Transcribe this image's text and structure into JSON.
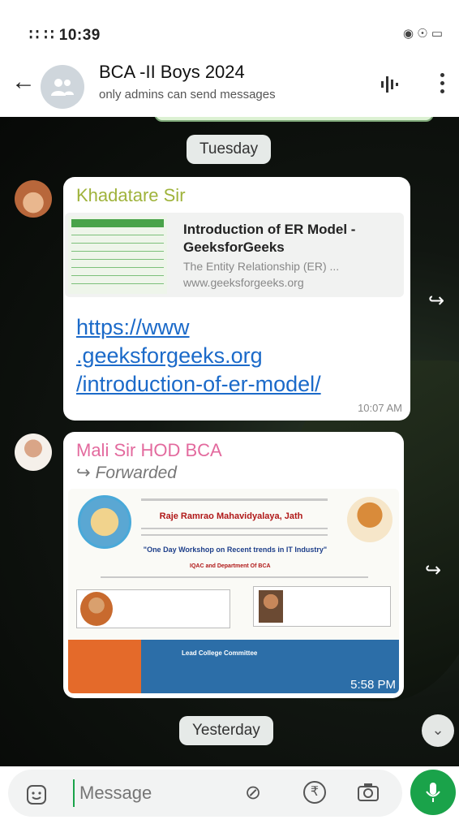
{
  "status_bar": {
    "time": "10:39",
    "left_icons": "∷ ∷",
    "right_icons": "◉ ☉ ▭"
  },
  "header": {
    "title": "BCA -II Boys 2024",
    "subtitle": "only admins can send messages"
  },
  "chat": {
    "date_chips": [
      "Tuesday",
      "Yesterday"
    ],
    "messages": [
      {
        "sender": "Khadatare Sir",
        "link_preview": {
          "title": "Introduction of ER Model - GeeksforGeeks",
          "description": "The Entity Relationship (ER) ...",
          "host": "www.geeksforgeeks.org"
        },
        "link": "https://www\n.geeksforgeeks.org\n/introduction-of-er-model/",
        "time": "10:07 AM"
      },
      {
        "sender": "Mali Sir HOD BCA",
        "forwarded_label": "Forwarded",
        "image_text": {
          "college": "Raje Ramrao Mahavidyalaya, Jath",
          "workshop": "\"One Day Workshop on Recent trends in IT Industry\"",
          "organizer": "IQAC and Department Of BCA",
          "band": "Lead College Committee"
        },
        "time": "5:58 PM"
      }
    ]
  },
  "input": {
    "placeholder": "Message"
  },
  "colors": {
    "accent": "#1aa34a",
    "sender1": "#9fb33b",
    "sender2": "#e36a9e",
    "link": "#1b6ac9"
  }
}
